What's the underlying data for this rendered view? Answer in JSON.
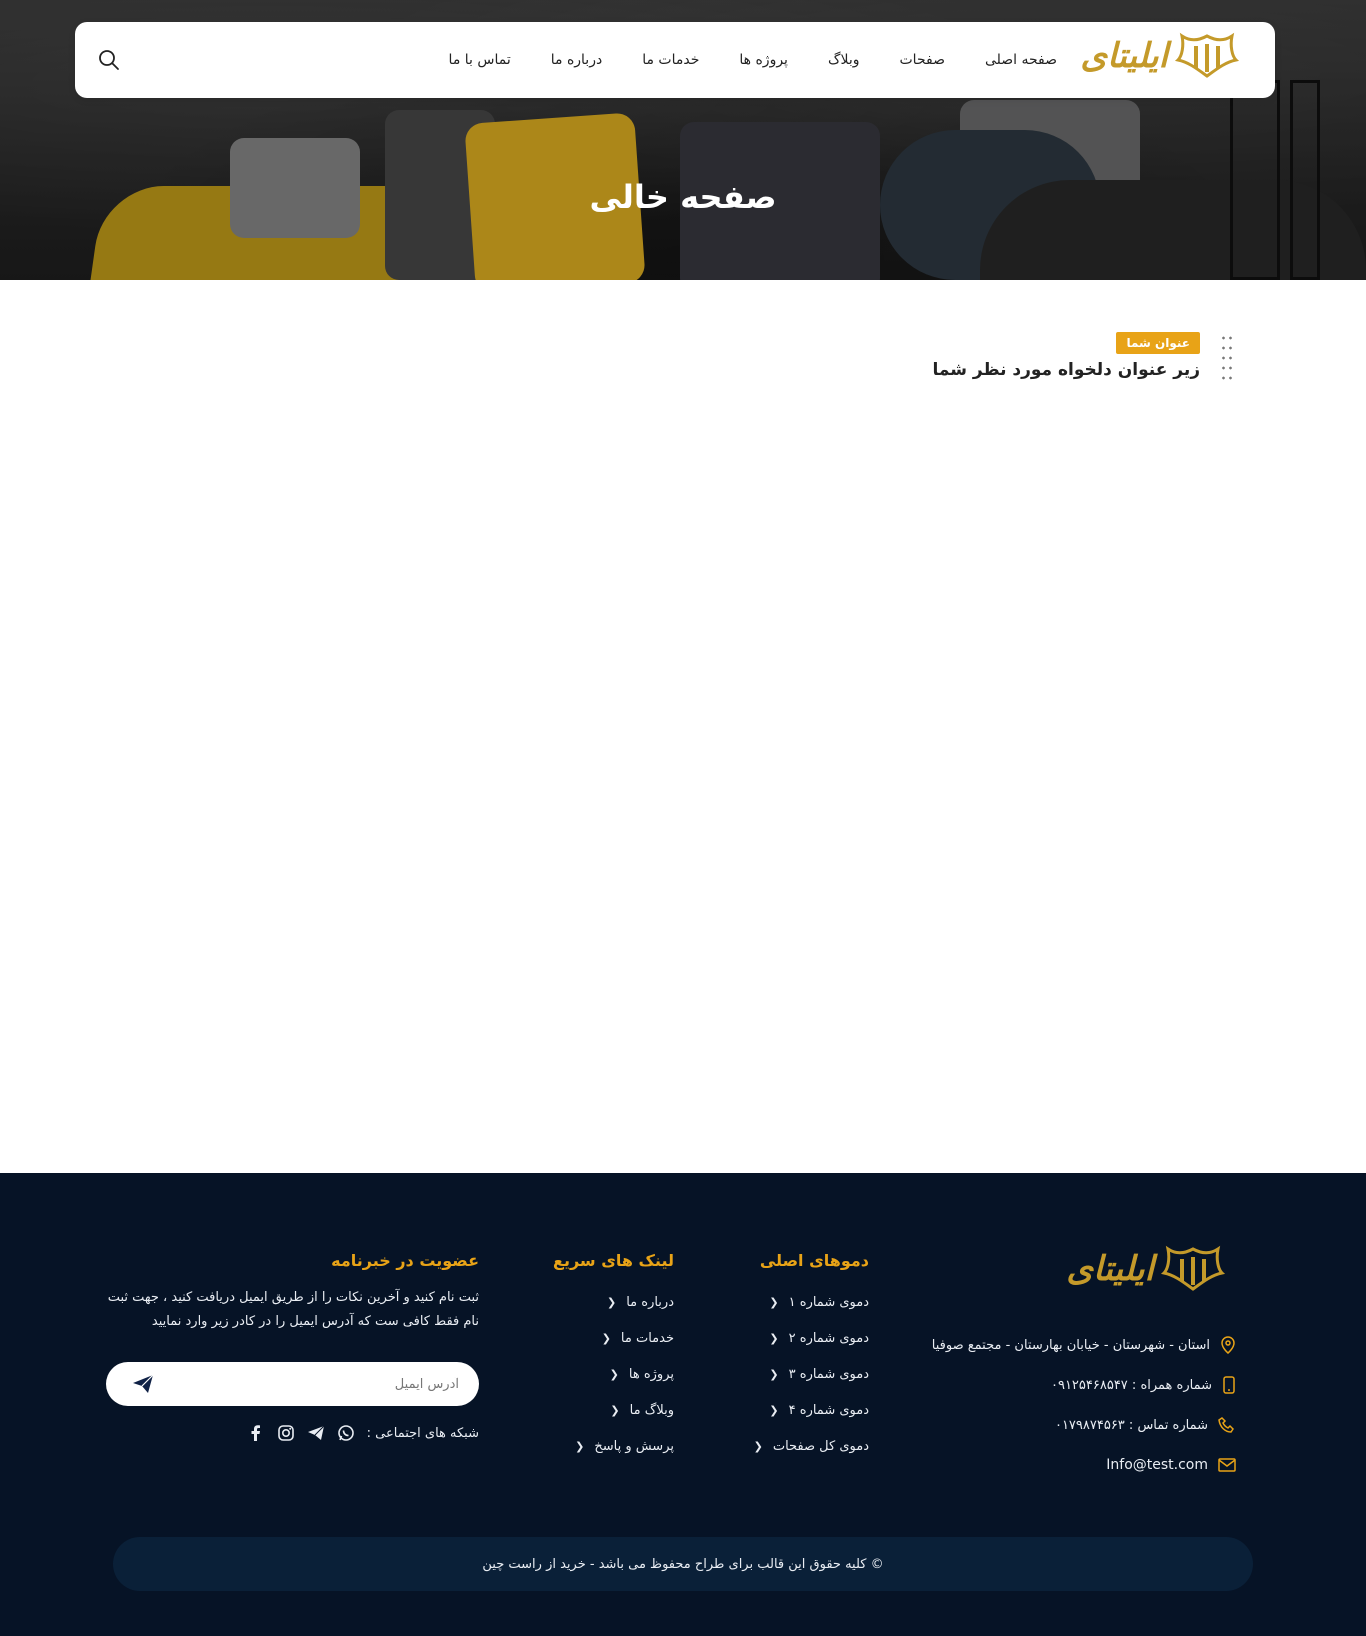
{
  "hero": {
    "title": "صفحه خالی"
  },
  "brand": {
    "name": "ایلیتای",
    "accent": "#c49a2a"
  },
  "nav": {
    "items": [
      "صفحه اصلی",
      "صفحات",
      "وبلاگ",
      "پروژه ها",
      "خدمات ما",
      "درباره ما",
      "تماس با ما"
    ],
    "search_icon": "search-icon"
  },
  "section": {
    "badge": "عنوان شما",
    "subtitle": "زیر عنوان دلخواه مورد نظر شما"
  },
  "footer": {
    "address": "استان - شهرستان - خیابان بهارستان - مجتمع صوفیا",
    "mobile": "شماره همراه : ۰۹۱۲۵۴۶۸۵۴۷",
    "phone": "شماره تماس : ۰۱۷۹۸۷۴۵۶۳",
    "email": "Info@test.com",
    "demos_title": "دموهای اصلی",
    "demos": [
      "دموی شماره ۱",
      "دموی شماره ۲",
      "دموی شماره ۳",
      "دموی شماره ۴",
      "دموی کل صفحات"
    ],
    "quick_title": "لینک های سریع",
    "quick": [
      "درباره ما",
      "خدمات ما",
      "پروژه ها",
      "وبلاگ ما",
      "پرسش و پاسخ"
    ],
    "newsletter_title": "عضویت در خبرنامه",
    "newsletter_text": "ثبت نام کنید و آخرین نکات را از طریق ایمیل دریافت کنید ، جهت ثبت نام فقط کافی ست که آدرس ایمیل را در کادر زیر وارد نمایید",
    "email_placeholder": "آدرس ایمیل",
    "social_label": "شبکه های اجتماعی :",
    "social_icons": [
      "whatsapp-icon",
      "telegram-icon",
      "instagram-icon",
      "facebook-icon"
    ],
    "copyright": "© کلیه حقوق این قالب برای طراح محفوظ می باشد -  خرید از راست چین"
  },
  "colors": {
    "accent": "#e8a317",
    "footer_bg": "#061326",
    "copy_bg": "#0a2038"
  }
}
